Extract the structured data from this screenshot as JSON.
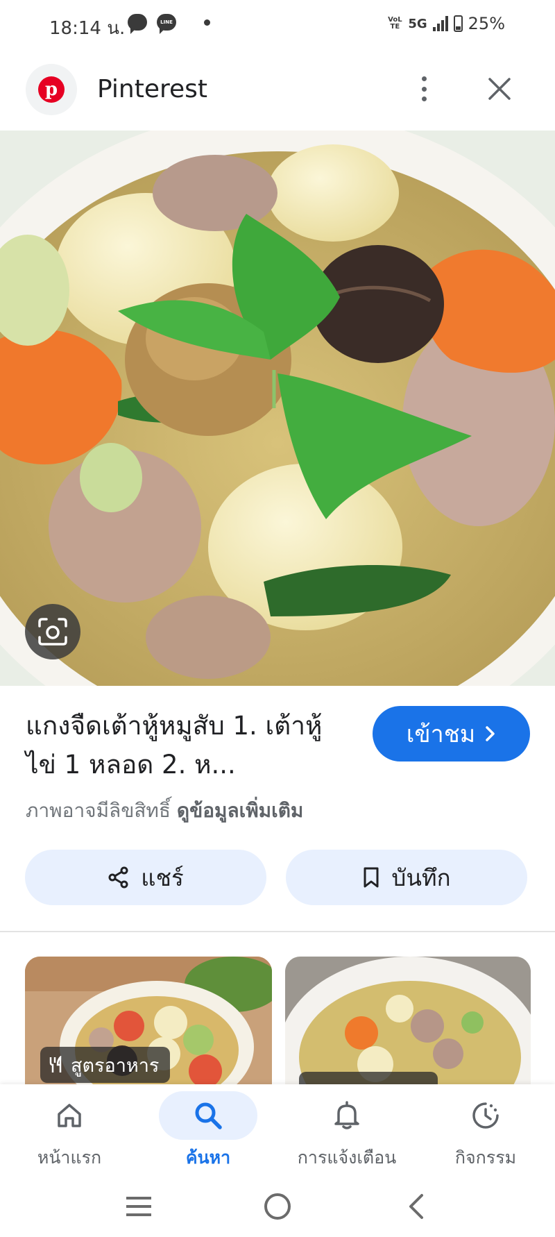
{
  "status_bar": {
    "time": "18:14 น.",
    "line_label": "LINE",
    "volte": "VoLTE",
    "network": "5G",
    "battery": "25%"
  },
  "header": {
    "logo_letter": "p",
    "title": "Pinterest"
  },
  "result": {
    "title": "แกงจืดเต้าหู้หมูสับ 1. เต้าหู้ไข่ 1 หลอด 2. ห...",
    "visit_label": "เข้าชม",
    "copyright_text": "ภาพอาจมีลิขสิทธิ์",
    "more_info_link": "ดูข้อมูลเพิ่มเติม",
    "share_label": "แชร์",
    "save_label": "บันทึก"
  },
  "related": [
    {
      "tag": "สูตรอาหาร"
    },
    {
      "tag": ""
    }
  ],
  "bottom_nav": [
    {
      "label": "หน้าแรก",
      "icon": "home-icon",
      "active": false
    },
    {
      "label": "ค้นหา",
      "icon": "search-icon",
      "active": true
    },
    {
      "label": "การแจ้งเตือน",
      "icon": "bell-icon",
      "active": false
    },
    {
      "label": "กิจกรรม",
      "icon": "activity-icon",
      "active": false
    }
  ],
  "colors": {
    "accent": "#1a73e8",
    "pill_bg": "#e8f0fe",
    "pinterest_red": "#e60023"
  }
}
